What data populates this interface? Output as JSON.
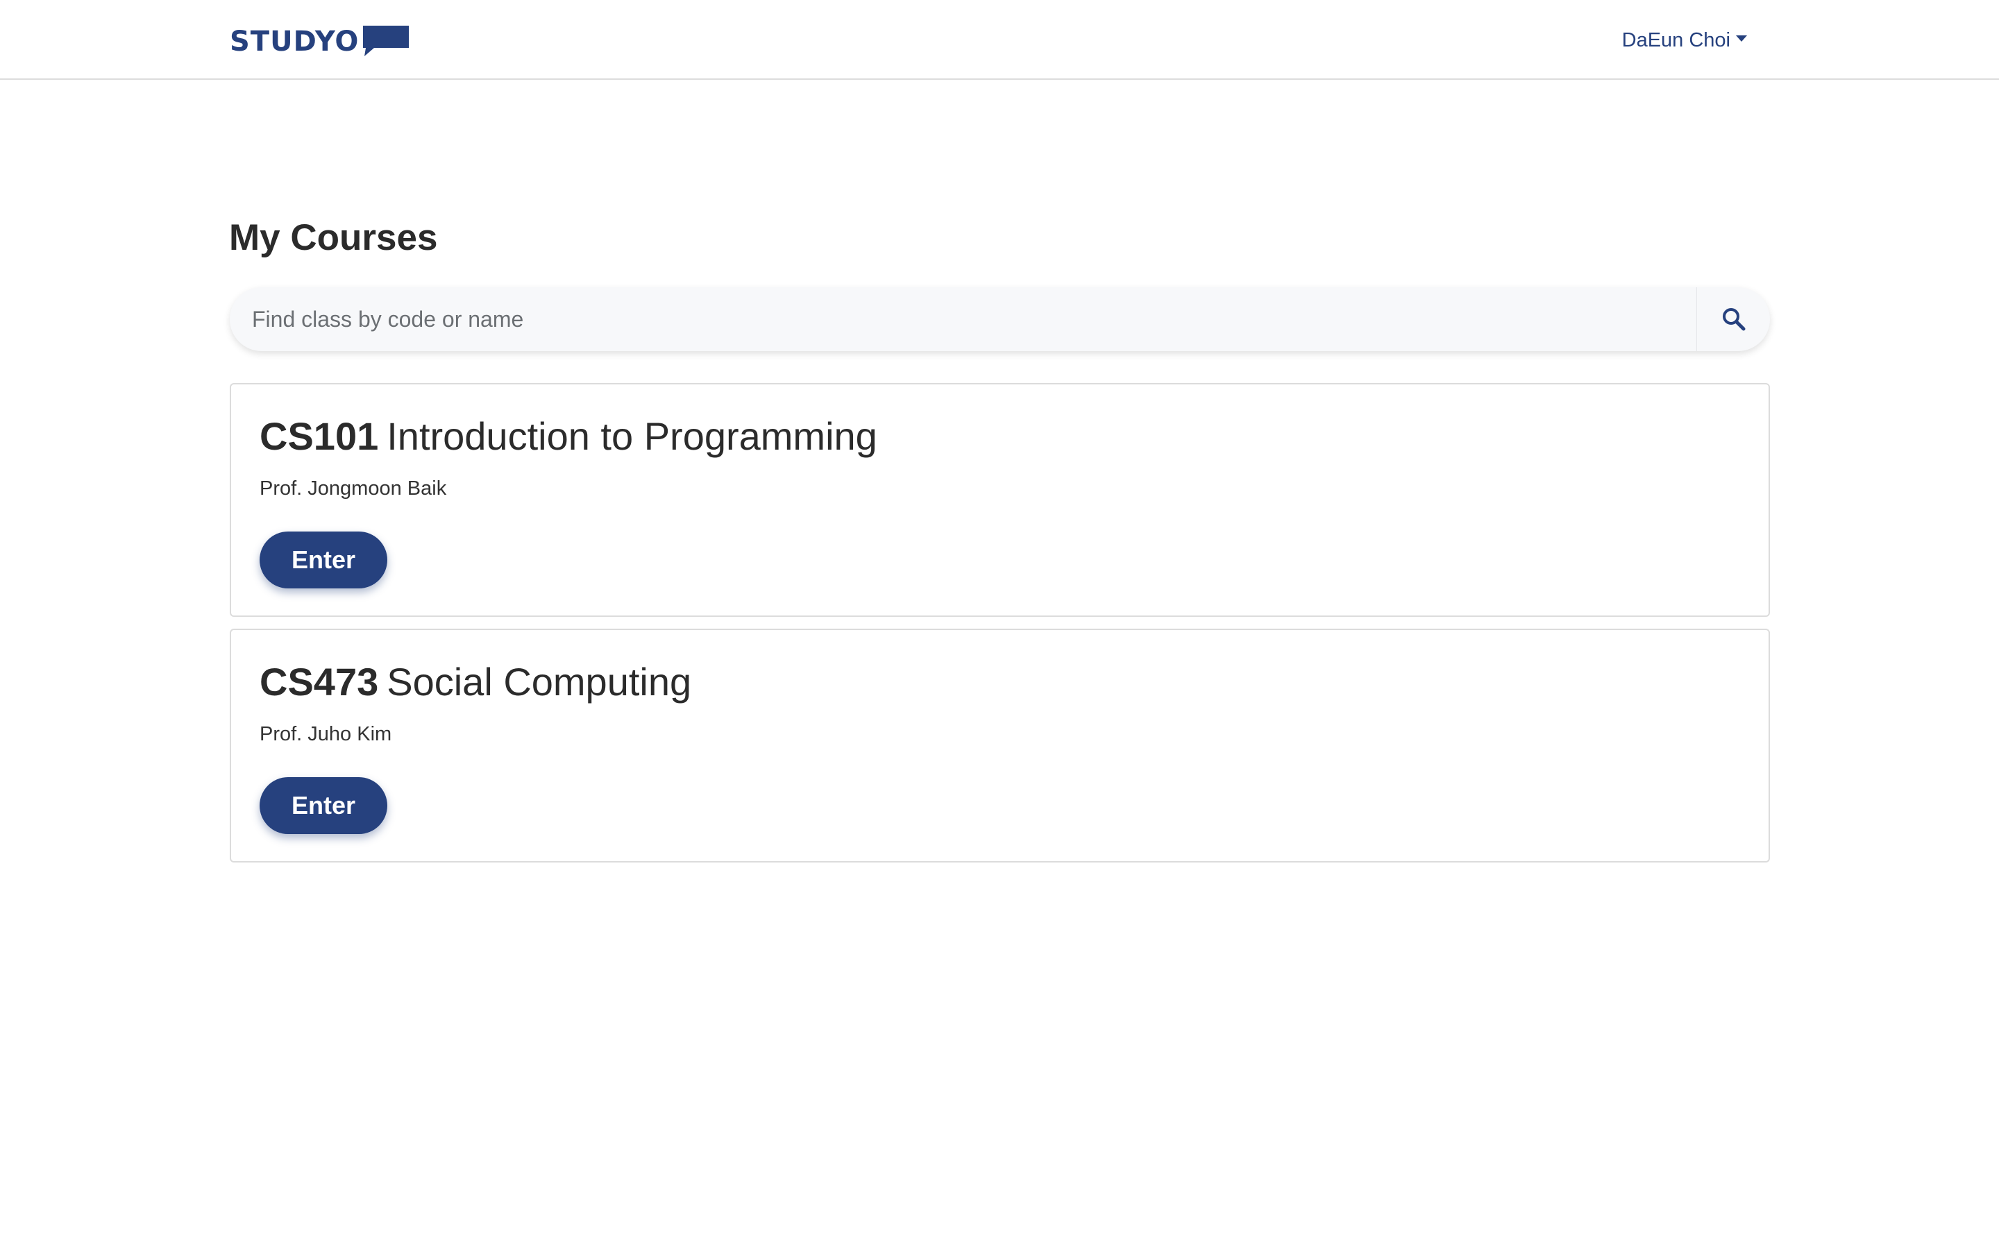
{
  "header": {
    "logo_text": "STUDYO",
    "user_name": "DaEun Choi"
  },
  "page": {
    "title": "My Courses"
  },
  "search": {
    "placeholder": "Find class by code or name",
    "value": ""
  },
  "courses": [
    {
      "code": "CS101",
      "name": "Introduction to Programming",
      "professor": "Prof. Jongmoon Baik",
      "button_label": "Enter"
    },
    {
      "code": "CS473",
      "name": "Social Computing",
      "professor": "Prof. Juho Kim",
      "button_label": "Enter"
    }
  ],
  "colors": {
    "brand": "#26417e",
    "border": "#dcdcdc",
    "search_bg": "#f7f8fa"
  },
  "icons": [
    "logo-bubble-icon",
    "caret-down-icon",
    "search-icon"
  ]
}
